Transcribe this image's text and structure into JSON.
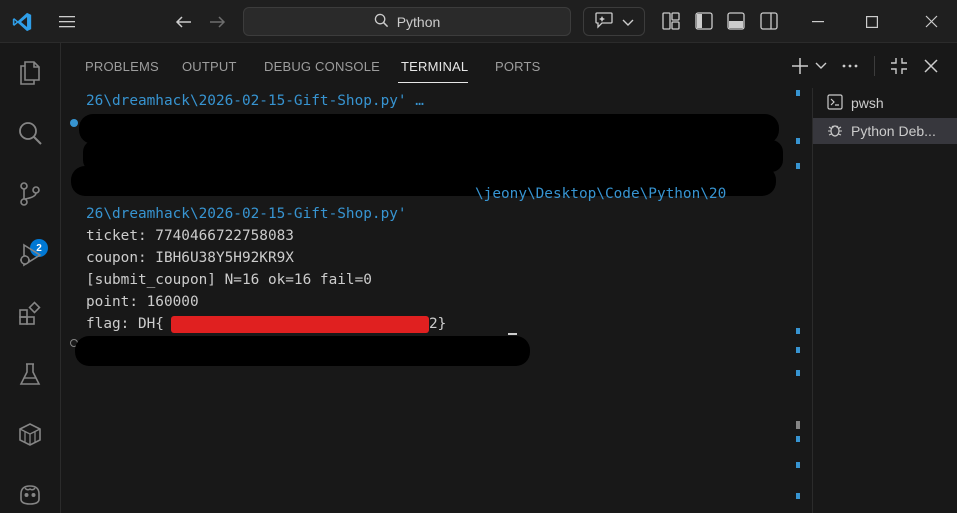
{
  "titlebar": {
    "search_text": "Python"
  },
  "activity_bar": {
    "source_control_badge": "2"
  },
  "panel": {
    "tabs": [
      {
        "label": "PROBLEMS",
        "active": false
      },
      {
        "label": "OUTPUT",
        "active": false
      },
      {
        "label": "DEBUG CONSOLE",
        "active": false
      },
      {
        "label": "TERMINAL",
        "active": true
      },
      {
        "label": "PORTS",
        "active": false
      }
    ]
  },
  "terminal": {
    "lines": [
      "26\\dreamhack\\2026-02-15-Gift-Shop.py' …",
      "26\\dreamhack\\2026-02-15-Gift-Shop.py'",
      "ticket: 7740466722758083",
      "coupon: IBH6U38Y5H92KR9X",
      "[submit_coupon] N=16 ok=16 fail=0",
      "point: 160000",
      "flag: DH{",
      "2}"
    ],
    "partial_path_fragment": "\\jeony\\Desktop\\Code\\Python\\20"
  },
  "terminal_list": [
    {
      "label": "pwsh",
      "icon": "terminal-icon",
      "selected": false
    },
    {
      "label": "Python Deb...",
      "icon": "debug-icon",
      "selected": true
    }
  ],
  "colors": {
    "accent": "#0078d4",
    "path": "#3794d1",
    "redaction_red": "#e02020"
  }
}
